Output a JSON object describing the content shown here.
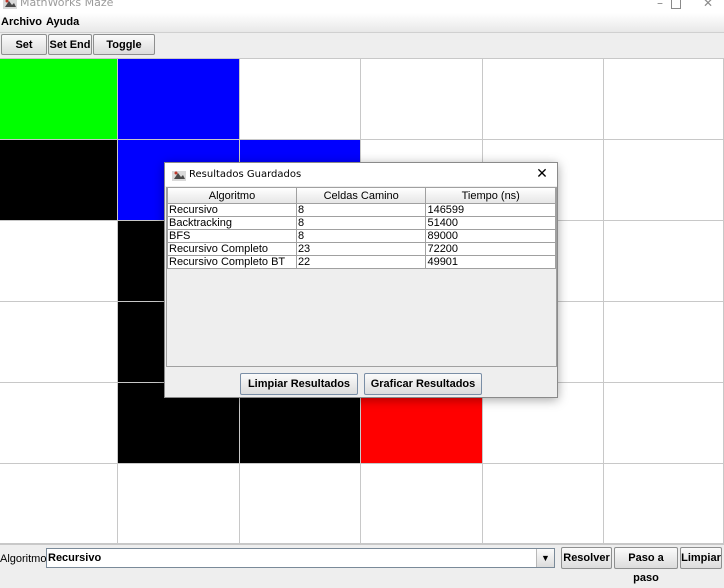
{
  "window": {
    "title": "MathWorks Maze"
  },
  "menu": {
    "items": [
      "Archivo",
      "Ayuda"
    ]
  },
  "toolbar": {
    "set_start": "Set Start",
    "set_end": "Set End",
    "toggle_wall": "Toggle Wall"
  },
  "maze": {
    "rows": 6,
    "cols": 6,
    "colors": {
      "start": "#00ff00",
      "end": "#ff0000",
      "path": "#0000ff",
      "wall": "#000000",
      "empty": "#ffffff"
    },
    "cells": [
      [
        "start",
        "path",
        "empty",
        "empty",
        "empty",
        "empty"
      ],
      [
        "wall",
        "path",
        "path",
        "empty",
        "empty",
        "empty"
      ],
      [
        "empty",
        "wall",
        "empty",
        "empty",
        "empty",
        "empty"
      ],
      [
        "empty",
        "wall",
        "empty",
        "empty",
        "empty",
        "empty"
      ],
      [
        "empty",
        "wall",
        "wall",
        "end",
        "empty",
        "empty"
      ],
      [
        "empty",
        "empty",
        "empty",
        "empty",
        "empty",
        "empty"
      ]
    ]
  },
  "dialog": {
    "title": "Resultados Guardados",
    "columns": [
      "Algoritmo",
      "Celdas Camino",
      "Tiempo (ns)"
    ],
    "rows": [
      [
        "Recursivo",
        "8",
        "146599"
      ],
      [
        "Backtracking",
        "8",
        "51400"
      ],
      [
        "BFS",
        "8",
        "89000"
      ],
      [
        "Recursivo Completo",
        "23",
        "72200"
      ],
      [
        "Recursivo Completo BT",
        "22",
        "49901"
      ]
    ],
    "clear_button": "Limpiar Resultados",
    "plot_button": "Graficar Resultados"
  },
  "bottom": {
    "algo_label": "Algoritmo:",
    "algo_selected": "Recursivo",
    "solve": "Resolver",
    "step": "Paso a paso",
    "clear": "Limpiar"
  }
}
